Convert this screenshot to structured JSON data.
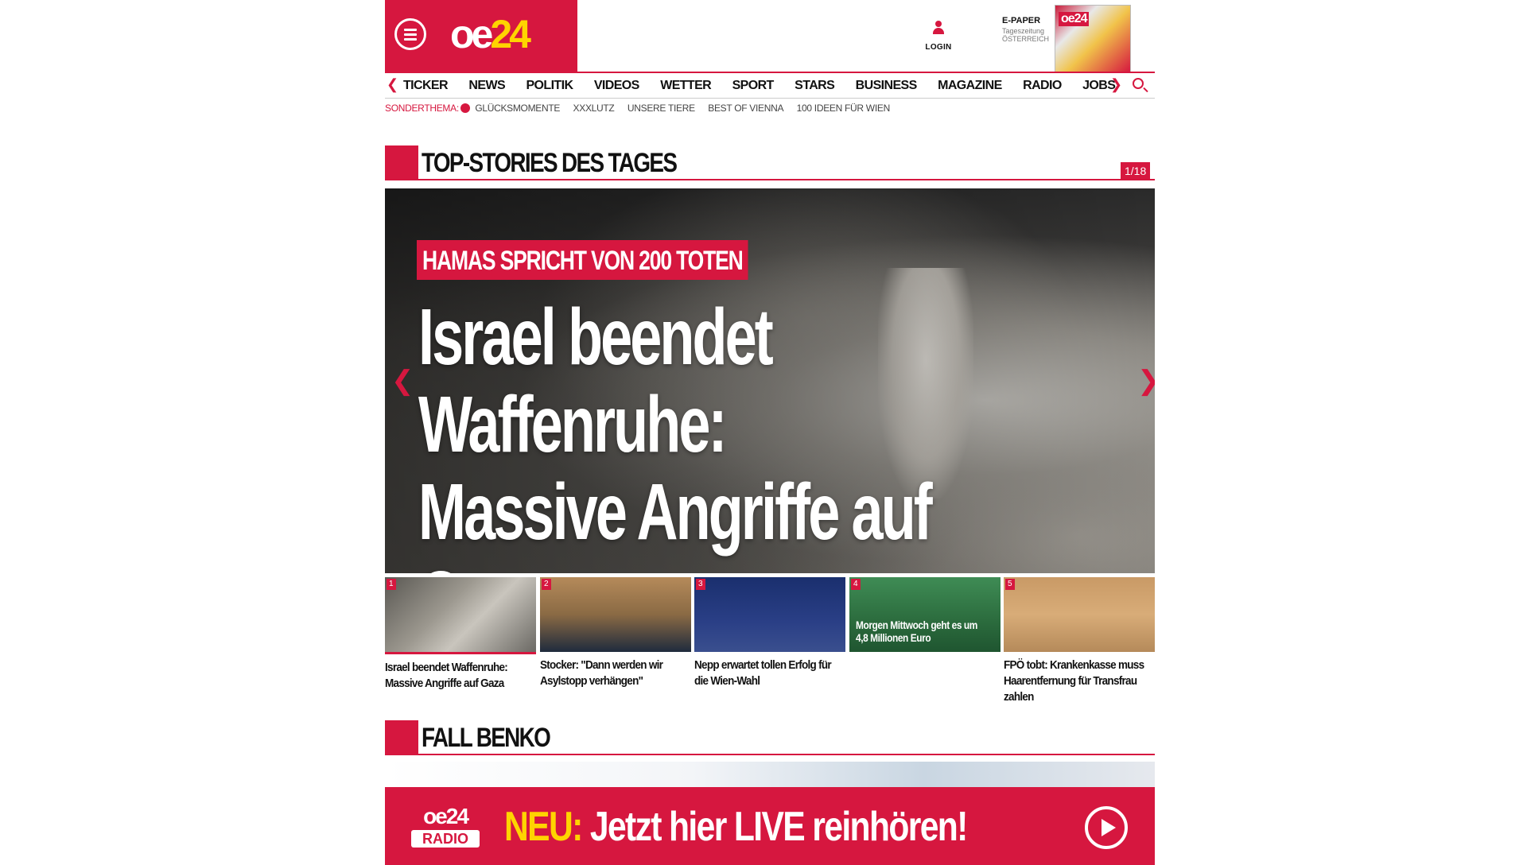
{
  "header": {
    "logo_main": "oe",
    "logo_num": "24",
    "login_label": "LOGIN",
    "epaper_title": "E-PAPER",
    "epaper_sub1": "Tageszeitung",
    "epaper_sub2": "ÖSTERREICH",
    "epaper_thumb_logo": "oe24"
  },
  "nav": {
    "items": [
      "TICKER",
      "NEWS",
      "POLITIK",
      "VIDEOS",
      "WETTER",
      "SPORT",
      "STARS",
      "BUSINESS",
      "MAGAZINE",
      "RADIO",
      "JOBS"
    ]
  },
  "subnav": {
    "label": "SONDERTHEMA:",
    "items": [
      "GLÜCKSMOMENTE",
      "XXXLUTZ",
      "UNSERE TIERE",
      "BEST OF VIENNA",
      "100 IDEEN FÜR WIEN"
    ]
  },
  "top_stories": {
    "title": "TOP-STORIES DES TAGES",
    "counter": "1/18",
    "hero": {
      "kicker": "HAMAS SPRICHT VON 200 TOTEN",
      "headline": "Israel beendet Waffenruhe: Massive Angriffe auf Gaza"
    },
    "thumbs": [
      {
        "num": "1",
        "caption": "Israel beendet Waffenruhe: Massive Angriffe auf Gaza",
        "overlay": ""
      },
      {
        "num": "2",
        "caption": "Stocker: \"Dann werden wir Asylstopp verhängen\"",
        "overlay": ""
      },
      {
        "num": "3",
        "caption": "Nepp erwartet tollen Erfolg für die Wien-Wahl",
        "overlay": ""
      },
      {
        "num": "4",
        "caption": "",
        "overlay": "Morgen Mittwoch geht es um 4,8 Millionen Euro"
      },
      {
        "num": "5",
        "caption": "FPÖ tobt: Krankenkasse muss Haarentfernung für Transfrau zahlen",
        "overlay": ""
      }
    ]
  },
  "benko": {
    "title": "FALL BENKO"
  },
  "radio_banner": {
    "logo_main": "oe24",
    "logo_sub": "RADIO",
    "neu": "NEU:",
    "text": " Jetzt hier LIVE reinhören!"
  },
  "colors": {
    "brand_red": "#d6173f",
    "accent_yellow": "#ffd400"
  }
}
